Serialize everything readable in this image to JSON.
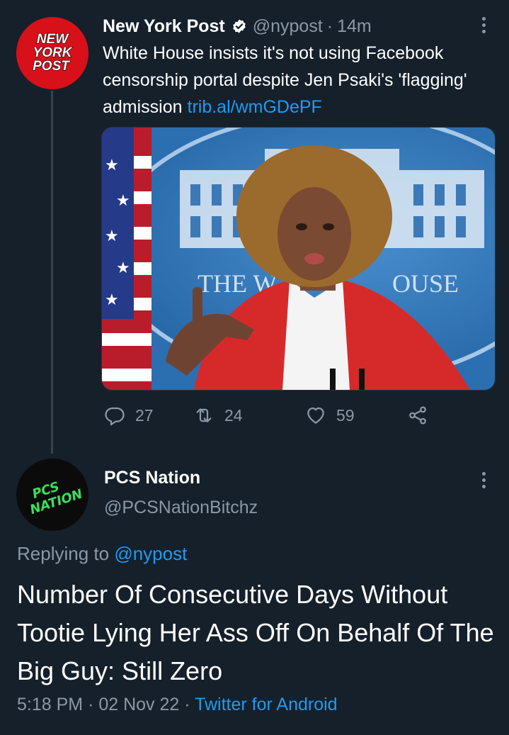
{
  "original_tweet": {
    "author_name": "New York Post",
    "avatar_text": [
      "NEW",
      "YORK",
      "POST"
    ],
    "handle": "@nypost",
    "separator": "·",
    "time": "14m",
    "text": "White House insists it's not using Facebook censorship portal despite Jen Psaki's 'flagging' admission ",
    "link": "trib.al/wmGDePF",
    "media": {
      "seal_text_left": "THE W",
      "seal_text_right": "OUSE"
    },
    "actions": {
      "replies": "27",
      "retweets": "24",
      "likes": "59"
    }
  },
  "reply_tweet": {
    "author_name": "PCS Nation",
    "avatar_text": [
      "PCS",
      "NATION"
    ],
    "handle": "@PCSNationBitchz",
    "replying_prefix": "Replying to ",
    "replying_handle": "@nypost",
    "text": "Number Of Consecutive Days Without Tootie Lying Her Ass Off On Behalf Of The Big Guy: Still Zero",
    "time": "5:18 PM",
    "date": "02 Nov 22",
    "separator": "·",
    "source": "Twitter for Android"
  },
  "colors": {
    "background": "#15202b",
    "text": "#ffffff",
    "muted": "#8b98a5",
    "link": "#1d9bf0",
    "nypost_red": "#d7101a",
    "pcs_green": "#39e05a"
  }
}
